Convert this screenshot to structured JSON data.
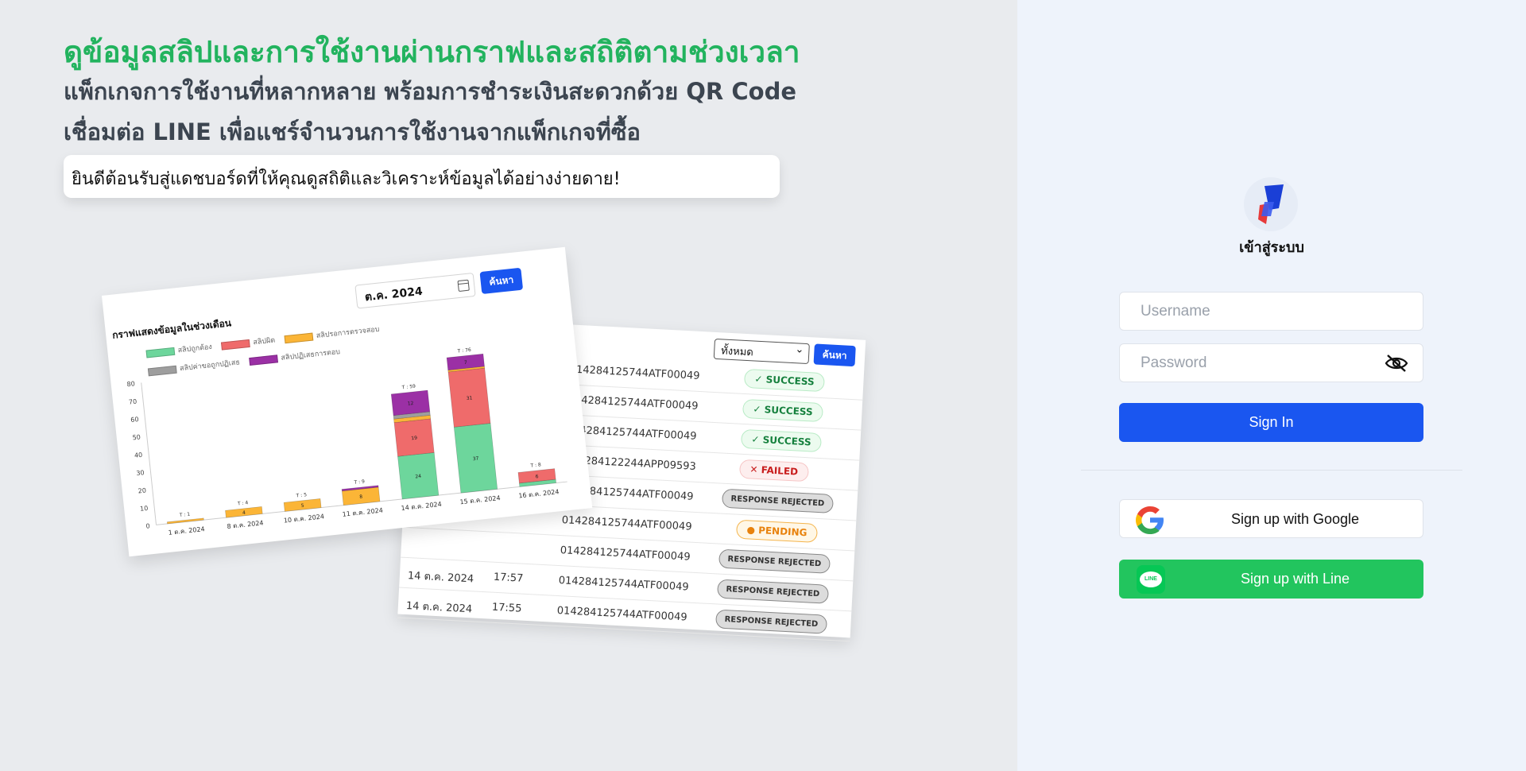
{
  "hero": {
    "headline": "ดูข้อมูลสลิปและการใช้งานผ่านกราฟและสถิติตามช่วงเวลา",
    "line1": "แพ็กเกจการใช้งานที่หลากหลาย พร้อมการชำระเงินสะดวกด้วย QR Code",
    "line2": "เชื่อมต่อ LINE เพื่อแชร์จำนวนการใช้งานจากแพ็กเกจที่ซื้อ",
    "welcome": "ยินดีต้อนรับสู่แดชบอร์ดที่ให้คุณดูสถิติและวิเคราะห์ข้อมูลได้อย่างง่ายดาย!"
  },
  "chart_panel": {
    "title": "กราฟแสดงข้อมูลในช่วงเดือน",
    "month_value": "ต.ค. 2024",
    "search_label": "ค้นหา"
  },
  "chart_data": {
    "type": "bar",
    "stacked": true,
    "title": "กราฟแสดงข้อมูลในช่วงเดือน",
    "categories": [
      "1 ต.ค. 2024",
      "8 ต.ค. 2024",
      "10 ต.ค. 2024",
      "11 ต.ค. 2024",
      "14 ต.ค. 2024",
      "15 ต.ค. 2024",
      "16 ต.ค. 2024"
    ],
    "totals": [
      "T : 1",
      "T : 4",
      "T : 5",
      "T : 9",
      "T : 59",
      "T : 76",
      "T : 8"
    ],
    "ylim": [
      0,
      80
    ],
    "yticks": [
      0,
      10,
      20,
      30,
      40,
      50,
      60,
      70,
      80
    ],
    "legend_position": "top",
    "series": [
      {
        "name": "สลิปถูกต้อง",
        "color": "#6dd69c",
        "values": [
          0,
          0,
          0,
          0,
          24,
          37,
          2
        ]
      },
      {
        "name": "สลิปผิด",
        "color": "#ef6b6b",
        "values": [
          0,
          0,
          0,
          0,
          19,
          31,
          6
        ]
      },
      {
        "name": "สลิปรอการตรวจสอบ",
        "color": "#fbb537",
        "values": [
          1,
          4,
          5,
          8,
          2,
          1,
          0
        ]
      },
      {
        "name": "สลิปค่าขอถูกปฏิเสธ",
        "color": "#9e9e9e",
        "values": [
          0,
          0,
          0,
          0,
          2,
          0,
          0
        ]
      },
      {
        "name": "สลิปปฏิเสธการตอบ",
        "color": "#9b30a5",
        "values": [
          0,
          0,
          0,
          1,
          12,
          7,
          0
        ]
      }
    ]
  },
  "table_panel": {
    "filter_value": "ทั้งหมด",
    "search_label": "ค้นหา",
    "rows": [
      {
        "date": "",
        "time": "",
        "ref": "014284125744ATF00049",
        "status": "SUCCESS",
        "kind": "success"
      },
      {
        "date": "",
        "time": "",
        "ref": "014284125744ATF00049",
        "status": "SUCCESS",
        "kind": "success"
      },
      {
        "date": "",
        "time": "",
        "ref": "014284125744ATF00049",
        "status": "SUCCESS",
        "kind": "success"
      },
      {
        "date": "",
        "time": "",
        "ref": "014284122244APP09593",
        "status": "FAILED",
        "kind": "failed"
      },
      {
        "date": "",
        "time": "",
        "ref": "014284125744ATF00049",
        "status": "RESPONSE REJECTED",
        "kind": "rejected"
      },
      {
        "date": "",
        "time": "",
        "ref": "014284125744ATF00049",
        "status": "PENDING",
        "kind": "pending"
      },
      {
        "date": "",
        "time": "",
        "ref": "014284125744ATF00049",
        "status": "RESPONSE REJECTED",
        "kind": "rejected"
      },
      {
        "date": "14 ต.ค. 2024",
        "time": "17:57",
        "ref": "014284125744ATF00049",
        "status": "RESPONSE REJECTED",
        "kind": "rejected"
      },
      {
        "date": "14 ต.ค. 2024",
        "time": "17:55",
        "ref": "014284125744ATF00049",
        "status": "RESPONSE REJECTED",
        "kind": "rejected"
      }
    ]
  },
  "login": {
    "title": "เข้าสู่ระบบ",
    "username_placeholder": "Username",
    "password_placeholder": "Password",
    "signin_label": "Sign In",
    "google_label": "Sign up with Google",
    "line_label": "Sign up with Line",
    "line_icon_text": "LINE"
  }
}
